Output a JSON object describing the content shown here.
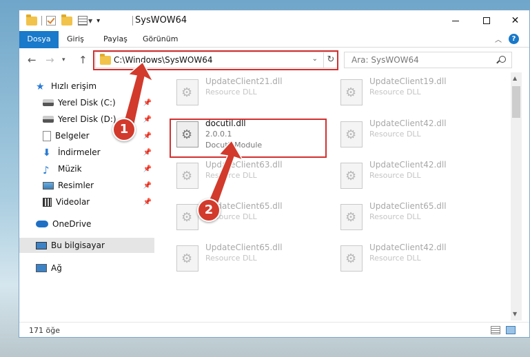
{
  "window": {
    "title": "SysWOW64"
  },
  "ribbon": {
    "tabs": [
      "Dosya",
      "Giriş",
      "Paylaş",
      "Görünüm"
    ],
    "help": "?"
  },
  "nav": {
    "address": "C:\\Windows\\SysWOW64",
    "search_placeholder": "Ara: SysWOW64"
  },
  "sidebar": {
    "items": [
      {
        "label": "Hızlı erişim"
      },
      {
        "label": "Yerel Disk (C:)"
      },
      {
        "label": "Yerel Disk (D:)"
      },
      {
        "label": "Belgeler"
      },
      {
        "label": "İndirmeler"
      },
      {
        "label": "Müzik"
      },
      {
        "label": "Resimler"
      },
      {
        "label": "Videolar"
      },
      {
        "label": "OneDrive"
      },
      {
        "label": "Bu bilgisayar"
      },
      {
        "label": "Ağ"
      }
    ]
  },
  "files": [
    {
      "name": "UpdateClient21.dll",
      "desc": "Resource DLL"
    },
    {
      "name": "UpdateClient19.dll",
      "desc": "Resource DLL"
    },
    {
      "name": "UpdateClient42.dll",
      "desc": "Resource DLL"
    },
    {
      "name": "UpdateClient63.dll",
      "desc": "Resource DLL"
    },
    {
      "name": "UpdateClient42.dll",
      "desc": "Resource DLL"
    },
    {
      "name": "UpdateClient65.dll",
      "desc": "Resource DLL"
    },
    {
      "name": "UpdateClient65.dll",
      "desc": "Resource DLL"
    },
    {
      "name": "UpdateClient65.dll",
      "desc": "Resource DLL"
    },
    {
      "name": "UpdateClient42.dll",
      "desc": "Resource DLL"
    }
  ],
  "highlighted_file": {
    "name": "docutil.dll",
    "version": "2.0.0.1",
    "desc": "Docutil Module"
  },
  "status": {
    "count": "171 öğe"
  },
  "annotations": {
    "step1": "1",
    "step2": "2",
    "color": "#d32f2f"
  }
}
